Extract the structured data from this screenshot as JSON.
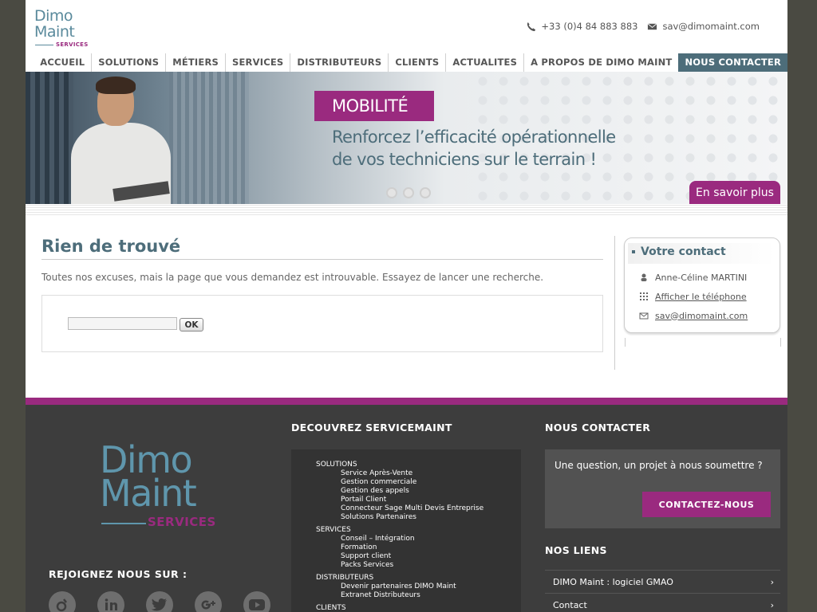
{
  "header": {
    "logo_line1": "Dimo",
    "logo_line2": "Maint",
    "logo_sub": "SERVICES",
    "phone": "+33 (0)4 84 883 883",
    "email": "sav@dimomaint.com"
  },
  "nav": {
    "items": [
      "ACCUEIL",
      "SOLUTIONS",
      "MÉTIERS",
      "SERVICES",
      "DISTRIBUTEURS",
      "CLIENTS",
      "ACTUALITES",
      "A PROPOS DE DIMO MAINT",
      "NOUS CONTACTER"
    ],
    "active": "NOUS CONTACTER"
  },
  "banner": {
    "badge": "MOBILITÉ",
    "line1": "Renforcez l’efficacité opérationnelle",
    "line2": "de vos techniciens sur le terrain !",
    "cta": "En savoir plus",
    "slides": 3
  },
  "main": {
    "title": "Rien de trouvé",
    "message": "Toutes nos excuses, mais la page que vous demandez est introuvable. Essayez de lancer une recherche.",
    "search_value": "",
    "search_button": "OK"
  },
  "sidebar": {
    "title": "Votre contact",
    "name": "Anne-Céline MARTINI",
    "phone_link": "Afficher le téléphone",
    "email": "sav@dimomaint.com"
  },
  "footer": {
    "logo_line1": "Dimo",
    "logo_line2": "Maint",
    "logo_sub": "SERVICES",
    "join_title": "REJOIGNEZ NOUS SUR :",
    "social_icons": [
      "viadeo-icon",
      "linkedin-icon",
      "twitter-icon",
      "google-plus-icon",
      "youtube-icon"
    ],
    "discover_title": "DECOUVREZ SERVICEMAINT",
    "discover_groups": [
      {
        "title": "SOLUTIONS",
        "items": [
          "Service Après-Vente",
          "Gestion commerciale",
          "Gestion des appels",
          "Portail Client",
          "Connecteur Sage Multi Devis Entreprise",
          "Solutions Partenaires"
        ]
      },
      {
        "title": "SERVICES",
        "items": [
          "Conseil – Intégration",
          "Formation",
          "Support client",
          "Packs Services"
        ]
      },
      {
        "title": "DISTRIBUTEURS",
        "items": [
          "Devenir partenaires DIMO Maint",
          "Extranet Distributeurs"
        ]
      },
      {
        "title": "CLIENTS",
        "items": []
      }
    ],
    "contact_title": "NOUS CONTACTER",
    "contact_text": "Une question, un projet à nous soumettre ?",
    "contact_button": "CONTACTEZ-NOUS",
    "links_title": "NOS LIENS",
    "links": [
      "DIMO Maint : logiciel GMAO",
      "Contact"
    ]
  },
  "colors": {
    "brand_purple": "#9a2a7f",
    "brand_teal": "#4d6d7a",
    "footer_bg": "#3d3d3d"
  }
}
